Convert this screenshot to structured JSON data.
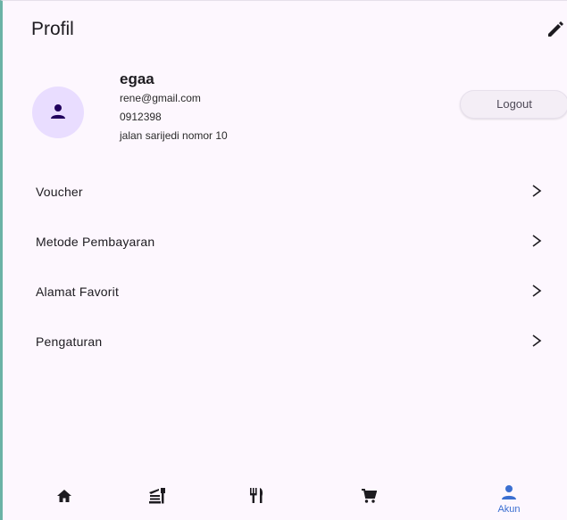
{
  "appbar": {
    "title": "Profil",
    "edit_icon": "edit-icon"
  },
  "profile": {
    "name": "egaa",
    "email": "rene@gmail.com",
    "phone": "0912398",
    "address": "jalan sarijedi nomor 10",
    "avatar_icon": "person-icon",
    "logout_label": "Logout"
  },
  "menu": {
    "items": [
      {
        "label": "Voucher",
        "chevron": ">"
      },
      {
        "label": "Metode Pembayaran",
        "chevron": ">"
      },
      {
        "label": "Alamat Favorit",
        "chevron": ">"
      },
      {
        "label": "Pengaturan",
        "chevron": ">"
      }
    ]
  },
  "nav": {
    "items": [
      {
        "icon": "home-icon",
        "label": ""
      },
      {
        "icon": "store-icon",
        "label": ""
      },
      {
        "icon": "restaurant-icon",
        "label": ""
      },
      {
        "icon": "cart-icon",
        "label": ""
      },
      {
        "icon": "person-icon",
        "label": "Akun",
        "active": true
      }
    ]
  },
  "colors": {
    "background": "#fdf7fe",
    "avatar_bg": "#e9ddff",
    "active_nav": "#3b6fd1",
    "icon_dark": "#1d1b20"
  }
}
